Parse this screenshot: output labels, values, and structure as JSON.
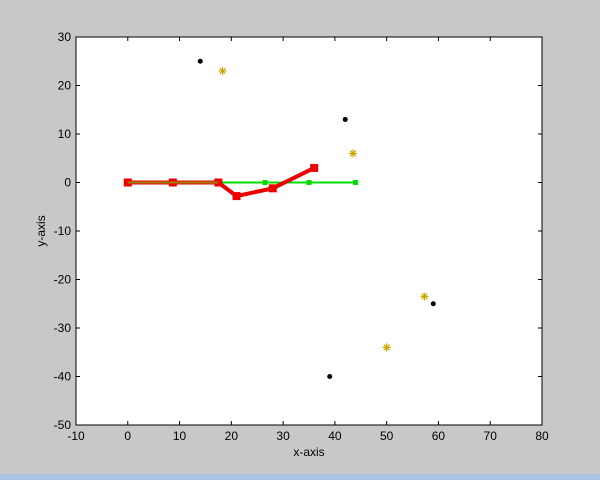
{
  "chart_data": {
    "type": "scatter",
    "xlabel": "x-axis",
    "ylabel": "y-axis",
    "xlim": [
      -10,
      80
    ],
    "ylim": [
      -50,
      30
    ],
    "xticks": [
      -10,
      0,
      10,
      20,
      30,
      40,
      50,
      60,
      70,
      80
    ],
    "yticks": [
      30,
      20,
      10,
      0,
      -10,
      -20,
      -30,
      -40,
      -50
    ],
    "grid": false,
    "legend": "none",
    "series": [
      {
        "style": "line-square-markers",
        "color": "#00dd00",
        "points": [
          [
            0,
            0
          ],
          [
            8.7,
            0
          ],
          [
            17.5,
            0
          ],
          [
            26.5,
            0
          ],
          [
            35,
            0
          ],
          [
            44,
            0
          ]
        ]
      },
      {
        "style": "line-square-markers",
        "color": "#ee0000",
        "points": [
          [
            0,
            0
          ],
          [
            8.7,
            0
          ],
          [
            17.5,
            0
          ],
          [
            21,
            -2.8
          ],
          [
            28,
            -1.2
          ],
          [
            36,
            3
          ]
        ]
      },
      {
        "style": "line",
        "color": "#a08000",
        "points": [
          [
            0,
            0
          ],
          [
            17.5,
            0
          ]
        ]
      },
      {
        "style": "dots",
        "color": "#000000",
        "points": [
          [
            14,
            25
          ],
          [
            42,
            13
          ],
          [
            59,
            -25
          ],
          [
            39,
            -40
          ]
        ]
      },
      {
        "style": "star-markers",
        "color": "#c8a800",
        "points": [
          [
            18.3,
            23
          ],
          [
            43.5,
            6
          ],
          [
            57.3,
            -23.5
          ],
          [
            50,
            -34
          ]
        ]
      }
    ]
  }
}
